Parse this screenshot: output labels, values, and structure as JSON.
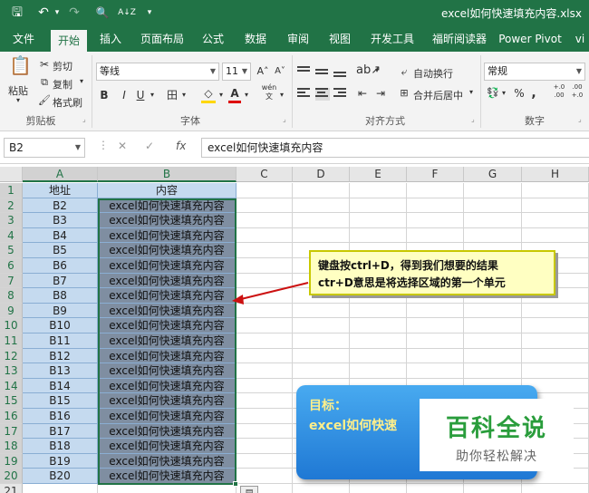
{
  "window": {
    "title": "excel如何快速填充内容.xlsx"
  },
  "quick_access": {
    "save": "🖫",
    "undo": "↶",
    "redo": "↷",
    "preview": "🔍",
    "sort": "A↓Z",
    "more": "▾"
  },
  "tabs": [
    "文件",
    "开始",
    "插入",
    "页面布局",
    "公式",
    "数据",
    "审阅",
    "视图",
    "开发工具",
    "福昕阅读器",
    "Power Pivot",
    "vi"
  ],
  "ribbon": {
    "clipboard": {
      "paste": "粘贴",
      "cut": "剪切",
      "copy": "复制",
      "format_painter": "格式刷",
      "group": "剪贴板"
    },
    "font": {
      "name": "等线",
      "size": "11",
      "grow": "A˄",
      "shrink": "A˅",
      "bold": "B",
      "italic": "I",
      "underline": "U",
      "border": "田",
      "fill": "◇",
      "color": "A",
      "wen": "wén\n文",
      "group": "字体"
    },
    "alignment": {
      "wrap": "自动换行",
      "merge": "合并后居中",
      "group": "对齐方式"
    },
    "number": {
      "format": "常规",
      "percent": "%",
      "comma": ",",
      "inc": "+.0\n.00",
      "dec": ".00\n+.0",
      "group": "数字"
    }
  },
  "formula_bar": {
    "name_box": "B2",
    "cancel": "✕",
    "enter": "✓",
    "fx": "fx",
    "content": "excel如何快速填充内容"
  },
  "grid": {
    "columns": [
      "A",
      "B",
      "C",
      "D",
      "E",
      "F",
      "G",
      "H"
    ],
    "header_row": {
      "A": "地址",
      "B": "内容"
    },
    "rows": [
      {
        "n": "1"
      },
      {
        "n": "2",
        "a": "B2",
        "b": "excel如何快速填充内容"
      },
      {
        "n": "3",
        "a": "B3",
        "b": "excel如何快速填充内容"
      },
      {
        "n": "4",
        "a": "B4",
        "b": "excel如何快速填充内容"
      },
      {
        "n": "5",
        "a": "B5",
        "b": "excel如何快速填充内容"
      },
      {
        "n": "6",
        "a": "B6",
        "b": "excel如何快速填充内容"
      },
      {
        "n": "7",
        "a": "B7",
        "b": "excel如何快速填充内容"
      },
      {
        "n": "8",
        "a": "B8",
        "b": "excel如何快速填充内容"
      },
      {
        "n": "9",
        "a": "B9",
        "b": "excel如何快速填充内容"
      },
      {
        "n": "10",
        "a": "B10",
        "b": "excel如何快速填充内容"
      },
      {
        "n": "11",
        "a": "B11",
        "b": "excel如何快速填充内容"
      },
      {
        "n": "12",
        "a": "B12",
        "b": "excel如何快速填充内容"
      },
      {
        "n": "13",
        "a": "B13",
        "b": "excel如何快速填充内容"
      },
      {
        "n": "14",
        "a": "B14",
        "b": "excel如何快速填充内容"
      },
      {
        "n": "15",
        "a": "B15",
        "b": "excel如何快速填充内容"
      },
      {
        "n": "16",
        "a": "B16",
        "b": "excel如何快速填充内容"
      },
      {
        "n": "17",
        "a": "B17",
        "b": "excel如何快速填充内容"
      },
      {
        "n": "18",
        "a": "B18",
        "b": "excel如何快速填充内容"
      },
      {
        "n": "19",
        "a": "B19",
        "b": "excel如何快速填充内容"
      },
      {
        "n": "20",
        "a": "B20",
        "b": "excel如何快速填充内容"
      },
      {
        "n": "21"
      }
    ]
  },
  "callout": {
    "line1": "键盘按ctrl+D，得到我们想要的结果",
    "line2": "ctr+D意思是将选择区域的第一个单元"
  },
  "goal": {
    "label": "目标：",
    "text": "excel如何快速"
  },
  "watermark": {
    "brand": "百科全说",
    "tagline": "助你轻松解决"
  },
  "colors": {
    "excel_green": "#217346",
    "selection_a": "#c5daef",
    "selection_b": "#7f8ea1",
    "arrow": "#cc1111"
  }
}
